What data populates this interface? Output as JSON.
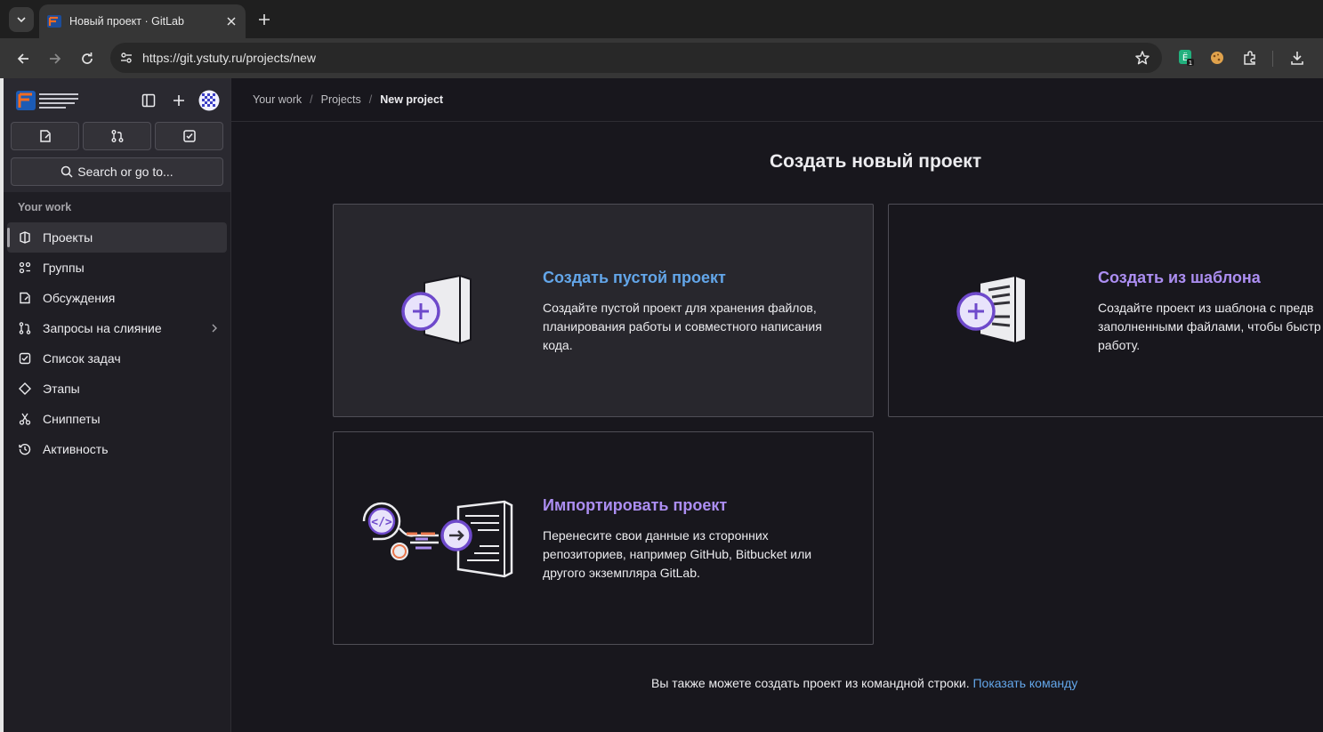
{
  "browser": {
    "tab_title": "Новый проект · GitLab",
    "url": "https://git.ystuty.ru/projects/new"
  },
  "sidebar": {
    "section_title": "Your work",
    "search_label": "Search or go to...",
    "items": [
      {
        "label": "Проекты",
        "icon": "project-icon",
        "active": true
      },
      {
        "label": "Группы",
        "icon": "group-icon"
      },
      {
        "label": "Обсуждения",
        "icon": "issues-icon"
      },
      {
        "label": "Запросы на слияние",
        "icon": "merge-request-icon"
      },
      {
        "label": "Список задач",
        "icon": "todo-icon"
      },
      {
        "label": "Этапы",
        "icon": "milestone-icon"
      },
      {
        "label": "Сниппеты",
        "icon": "snippet-icon"
      },
      {
        "label": "Активность",
        "icon": "history-icon"
      }
    ]
  },
  "breadcrumb": {
    "items": [
      "Your work",
      "Projects",
      "New project"
    ]
  },
  "main": {
    "title": "Создать новый проект",
    "cards": [
      {
        "title": "Создать пустой проект",
        "description": "Создайте пустой проект для хранения файлов, планирования работы и совместного написания кода."
      },
      {
        "title": "Создать из шаблона",
        "description": "Создайте проект из шаблона с предв заполненными файлами, чтобы быстр работу."
      },
      {
        "title": "Импортировать проект",
        "description": "Перенесите свои данные из сторонних репозиториев, например GitHub, Bitbucket или другого экземпляра GitLab."
      }
    ],
    "footer_text": "Вы также можете создать проект из командной строки.",
    "footer_link": "Показать команду"
  },
  "colors": {
    "accent_blue": "#63a6e9",
    "accent_purple": "#ac8ef2",
    "background": "#18171d"
  }
}
